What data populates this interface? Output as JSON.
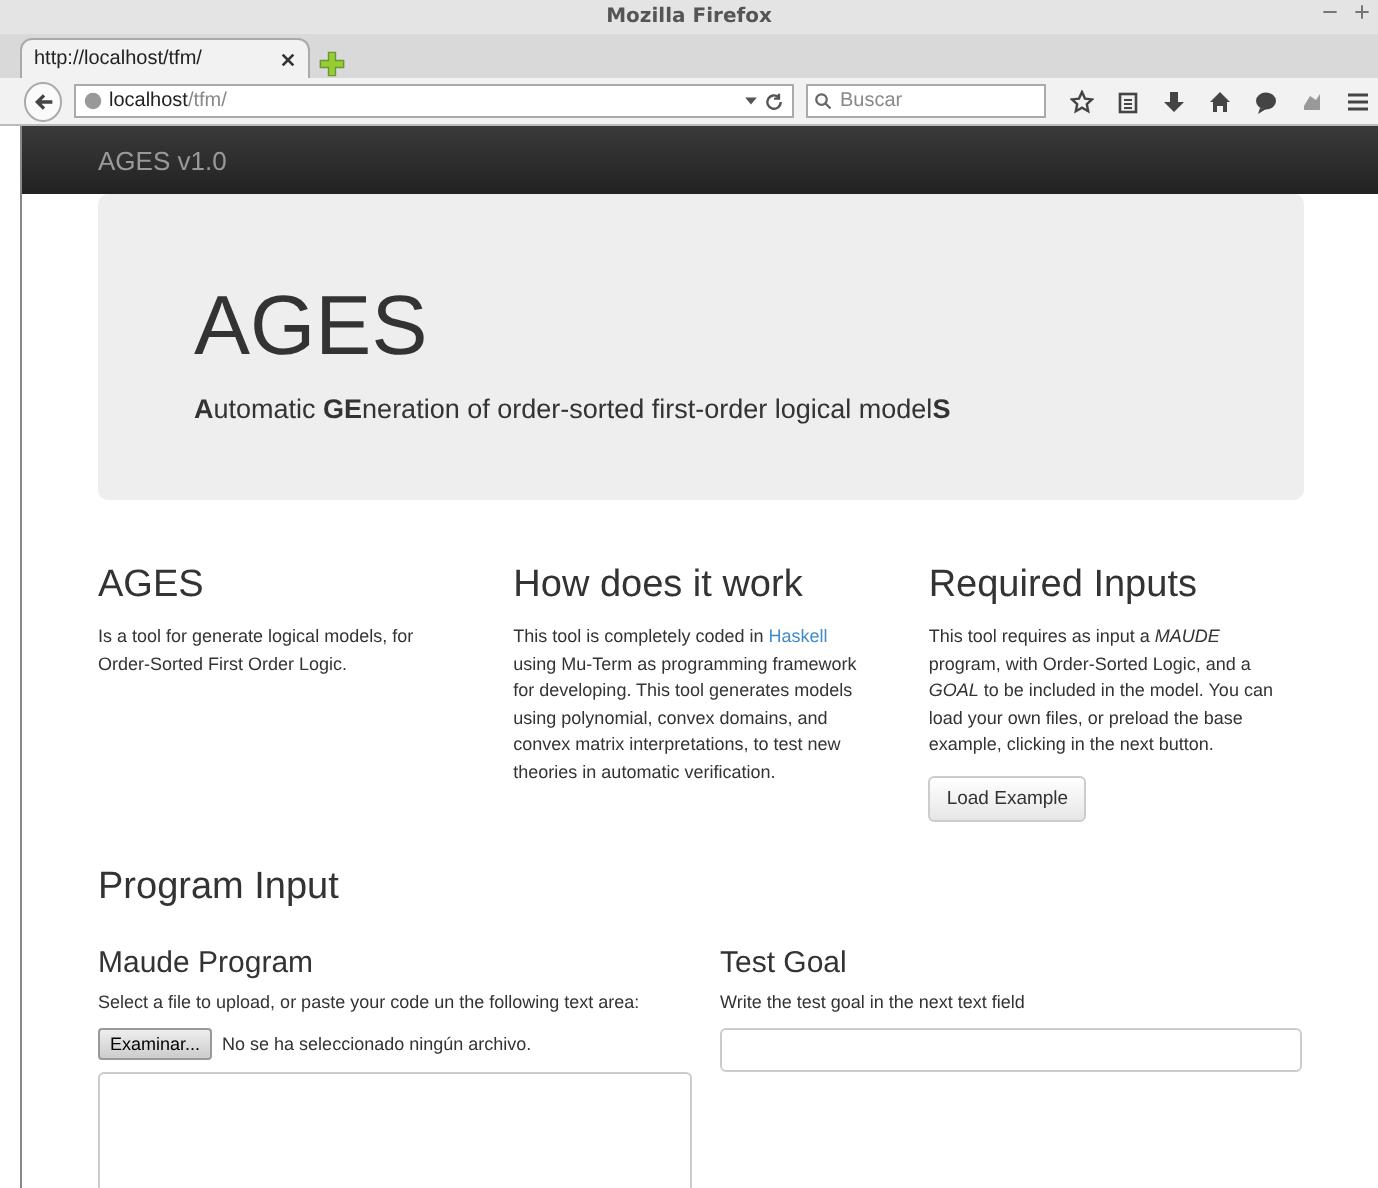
{
  "window": {
    "title": "Mozilla Firefox"
  },
  "tabs": [
    {
      "label": "http://localhost/tfm/",
      "selected": true
    }
  ],
  "address_bar": {
    "host": "localhost",
    "path": "/tfm/"
  },
  "search": {
    "placeholder": "Buscar"
  },
  "navbar": {
    "brand": "AGES v1.0"
  },
  "jumbotron": {
    "title": "AGES",
    "subtitle": "**A**utomatic **GE**neration of order-sorted first-order logical model**S**"
  },
  "columns": [
    {
      "heading": "AGES",
      "text": [
        {
          "kind": "text",
          "value": "Is a tool for generate logical models, for Order-Sorted First Order Logic."
        }
      ]
    },
    {
      "heading": "How does it work",
      "text": [
        {
          "kind": "text",
          "value": "This tool is completely coded in "
        },
        {
          "kind": "link",
          "value": "Haskell"
        },
        {
          "kind": "text",
          "value": " using Mu-Term as programming framework for developing. This tool generates models using polynomial, convex domains, and convex matrix interpretations, to test new theories in automatic verification."
        }
      ]
    },
    {
      "heading": "Required Inputs",
      "text": [
        {
          "kind": "text",
          "value": "This tool requires as input a *MAUDE* program, with Order-Sorted Logic, and a *GOAL* to be included in the model. You can load your own files, or preload the base example, clicking in the next button."
        }
      ],
      "button": "Load Example"
    }
  ],
  "program_input": {
    "heading": "Program Input",
    "maude": {
      "heading": "Maude Program",
      "help": "Select a file to upload, or paste your code un the following text area:",
      "file_button": "Examinar...",
      "file_status": "No se ha seleccionado ningún archivo."
    },
    "goal": {
      "heading": "Test Goal",
      "help": "Write the test goal in the next text field"
    }
  }
}
